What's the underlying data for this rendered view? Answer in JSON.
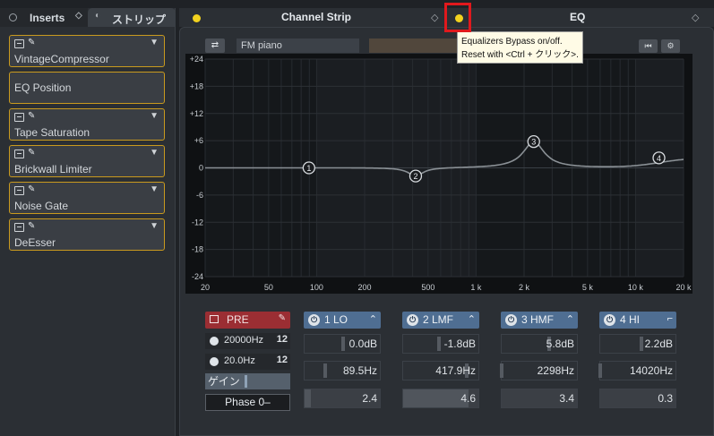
{
  "left_panel": {
    "tabs": [
      "Inserts",
      "ストリップ"
    ],
    "slots": [
      {
        "name": "VintageCompressor"
      },
      {
        "name": "EQ Position"
      },
      {
        "name": "Tape Saturation"
      },
      {
        "name": "Brickwall Limiter"
      },
      {
        "name": "Noise Gate"
      },
      {
        "name": "DeEsser"
      }
    ]
  },
  "headers": {
    "channel_strip": "Channel Strip",
    "eq": "EQ"
  },
  "toolbar": {
    "preset_name": "FM piano"
  },
  "tooltip": {
    "line1": "Equalizers Bypass on/off.",
    "line2": "Reset with <Ctrl + クリック>."
  },
  "graph": {
    "y_ticks": [
      "+24",
      "+18",
      "+12",
      "+6",
      "0",
      "-6",
      "-12",
      "-18",
      "-24"
    ],
    "x_ticks": [
      "20",
      "50",
      "100",
      "200",
      "500",
      "1 k",
      "2 k",
      "5 k",
      "10 k",
      "20 k"
    ],
    "bands": [
      {
        "num": "1",
        "freq": 89.5,
        "gain": 0.0
      },
      {
        "num": "2",
        "freq": 417.9,
        "gain": -1.8
      },
      {
        "num": "3",
        "freq": 2298,
        "gain": 5.8
      },
      {
        "num": "4",
        "freq": 14020,
        "gain": 2.2
      }
    ]
  },
  "pre": {
    "label": "PRE",
    "hp_freq": "20000Hz",
    "lp_freq": "20.0Hz",
    "slope_icon": "12",
    "gain_label": "ゲイン",
    "phase_label": "Phase 0–"
  },
  "bands": [
    {
      "title": "1 LO",
      "gain": "0.0dB",
      "freq": "89.5Hz",
      "q": "2.4",
      "gain_level": 0.5,
      "freq_level": 0.27,
      "q_level": 0.08
    },
    {
      "title": "2 LMF",
      "gain": "-1.8dB",
      "freq": "417.9Hz",
      "q": "4.6",
      "gain_level": 0.46,
      "freq_level": 0.82,
      "q_level": 0.87
    },
    {
      "title": "3 HMF",
      "gain": "5.8dB",
      "freq": "2298Hz",
      "q": "3.4",
      "gain_level": 0.62,
      "freq_level": 0.0,
      "q_level": 0.0
    },
    {
      "title": "4 HI",
      "gain": "2.2dB",
      "freq": "14020Hz",
      "q": "0.3",
      "gain_level": 0.54,
      "freq_level": 0.0,
      "q_level": 0.0
    }
  ]
}
